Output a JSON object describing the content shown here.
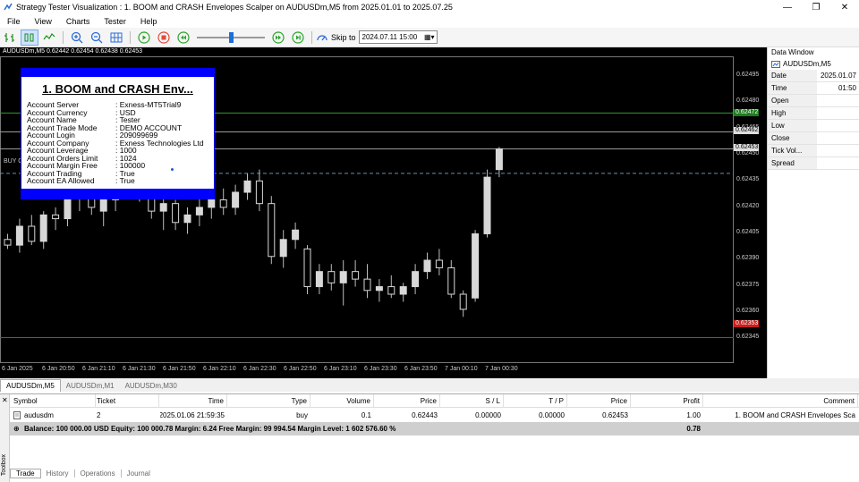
{
  "window": {
    "title": "Strategy Tester Visualization : 1. BOOM and CRASH Envelopes Scalper on AUDUSDm,M5 from 2025.01.01 to 2025.07.25"
  },
  "menu": [
    "File",
    "View",
    "Charts",
    "Tester",
    "Help"
  ],
  "toolbar": {
    "skip_label": "Skip to",
    "skip_date": "2024.07.11 15:00",
    "speed_fraction": 0.5
  },
  "chart": {
    "header": "AUDUSDm,M5  0.62442 0.62454 0.62438 0.62453",
    "buy_label": "BUY C",
    "price_labels": [
      "0.62495",
      "0.62480",
      "0.62465",
      "0.62450",
      "0.62435",
      "0.62420",
      "0.62405",
      "0.62390",
      "0.62375",
      "0.62360",
      "0.62345"
    ],
    "tag_green": "0.62472",
    "tag_gray1": "0.62462",
    "tag_gray2": "0.62453",
    "tag_red": "0.62353",
    "time_labels": [
      "6 Jan 2025",
      "6 Jan 20:50",
      "6 Jan 21:10",
      "6 Jan 21:30",
      "6 Jan 21:50",
      "6 Jan 22:10",
      "6 Jan 22:30",
      "6 Jan 22:50",
      "6 Jan 23:10",
      "6 Jan 23:30",
      "6 Jan 23:50",
      "7 Jan 00:10",
      "7 Jan 00:30"
    ]
  },
  "chart_data": {
    "type": "candlestick",
    "ohlc": [
      [
        0.62405,
        0.62408,
        0.624,
        0.62402
      ],
      [
        0.62402,
        0.62416,
        0.62398,
        0.62412
      ],
      [
        0.62412,
        0.62418,
        0.62402,
        0.62404
      ],
      [
        0.62404,
        0.6242,
        0.624,
        0.62418
      ],
      [
        0.62418,
        0.62422,
        0.6241,
        0.62416
      ],
      [
        0.62416,
        0.6244,
        0.62412,
        0.62435
      ],
      [
        0.6243,
        0.62444,
        0.6242,
        0.6244
      ],
      [
        0.6244,
        0.62444,
        0.62418,
        0.62422
      ],
      [
        0.6242,
        0.6243,
        0.62412,
        0.62426
      ],
      [
        0.62426,
        0.62438,
        0.6242,
        0.62432
      ],
      [
        0.6244,
        0.6245,
        0.6243,
        0.62442
      ],
      [
        0.62438,
        0.62445,
        0.62425,
        0.6243
      ],
      [
        0.62428,
        0.6244,
        0.62416,
        0.6242
      ],
      [
        0.6242,
        0.62428,
        0.6241,
        0.62424
      ],
      [
        0.62424,
        0.62426,
        0.6241,
        0.62414
      ],
      [
        0.62414,
        0.62422,
        0.62408,
        0.62418
      ],
      [
        0.62418,
        0.62428,
        0.62412,
        0.62422
      ],
      [
        0.62422,
        0.6243,
        0.62416,
        0.62426
      ],
      [
        0.62426,
        0.62432,
        0.62418,
        0.62422
      ],
      [
        0.62422,
        0.62434,
        0.62418,
        0.6243
      ],
      [
        0.6243,
        0.6244,
        0.62426,
        0.62436
      ],
      [
        0.62436,
        0.62442,
        0.6242,
        0.62424
      ],
      [
        0.62424,
        0.62428,
        0.62392,
        0.62396
      ],
      [
        0.62396,
        0.6241,
        0.6239,
        0.62405
      ],
      [
        0.62405,
        0.62414,
        0.624,
        0.6241
      ],
      [
        0.624,
        0.62402,
        0.62376,
        0.6238
      ],
      [
        0.6238,
        0.62392,
        0.62376,
        0.62388
      ],
      [
        0.62388,
        0.62392,
        0.62378,
        0.62382
      ],
      [
        0.62382,
        0.62394,
        0.6237,
        0.62388
      ],
      [
        0.62388,
        0.62394,
        0.6238,
        0.62384
      ],
      [
        0.62384,
        0.62392,
        0.62374,
        0.62378
      ],
      [
        0.62378,
        0.62384,
        0.62372,
        0.6238
      ],
      [
        0.6238,
        0.62386,
        0.62374,
        0.62376
      ],
      [
        0.62376,
        0.62382,
        0.62372,
        0.6238
      ],
      [
        0.6238,
        0.62392,
        0.62376,
        0.62388
      ],
      [
        0.62388,
        0.62398,
        0.62384,
        0.62394
      ],
      [
        0.62394,
        0.624,
        0.62386,
        0.6239
      ],
      [
        0.6239,
        0.62394,
        0.62374,
        0.62376
      ],
      [
        0.62376,
        0.62378,
        0.62364,
        0.62368
      ],
      [
        0.62374,
        0.6241,
        0.62372,
        0.62408
      ],
      [
        0.62408,
        0.62442,
        0.62406,
        0.62438
      ],
      [
        0.62442,
        0.62454,
        0.62438,
        0.62453
      ]
    ],
    "ylim": [
      0.6234,
      0.62502
    ],
    "levels": [
      0.62472,
      0.62462,
      0.62453,
      0.6244,
      0.62353
    ]
  },
  "info_panel": {
    "title": "1. BOOM and CRASH Env...",
    "rows": [
      {
        "k": "Account Server",
        "v": ": Exness-MT5Trial9"
      },
      {
        "k": "Account Currency",
        "v": ": USD"
      },
      {
        "k": "Account Name",
        "v": ": Tester"
      },
      {
        "k": "Account Trade Mode",
        "v": ": DEMO ACCOUNT"
      },
      {
        "k": "Account Login",
        "v": ": 209099699"
      },
      {
        "k": "Account Company",
        "v": ": Exness Technologies Ltd"
      },
      {
        "k": "Account Leverage",
        "v": ": 1000"
      },
      {
        "k": "Account Orders Limit",
        "v": ": 1024"
      },
      {
        "k": "Account Margin Free",
        "v": ": 100000"
      },
      {
        "k": "Account Trading",
        "v": ": True"
      },
      {
        "k": "Account EA Allowed",
        "v": ": True"
      }
    ]
  },
  "data_window": {
    "title": "Data Window",
    "symbol": "AUDUSDm,M5",
    "rows": [
      {
        "k": "Date",
        "v": "2025.01.07"
      },
      {
        "k": "Time",
        "v": "01:50"
      },
      {
        "k": "Open",
        "v": ""
      },
      {
        "k": "High",
        "v": ""
      },
      {
        "k": "Low",
        "v": ""
      },
      {
        "k": "Close",
        "v": ""
      },
      {
        "k": "Tick Vol...",
        "v": ""
      },
      {
        "k": "Spread",
        "v": ""
      }
    ]
  },
  "chart_tabs": [
    "AUDUSDm,M5",
    "AUDUSDm,M1",
    "AUDUSDm,M30"
  ],
  "trade_table": {
    "headers": [
      "Symbol",
      "Ticket",
      "Time",
      "Type",
      "Volume",
      "Price",
      "S / L",
      "T / P",
      "Price",
      "Profit",
      "Comment"
    ],
    "row": [
      "audusdm",
      "2",
      "2025.01.06 21:59:35",
      "buy",
      "0.1",
      "0.62443",
      "0.00000",
      "0.00000",
      "0.62453",
      "1.00",
      "1. BOOM and CRASH Envelopes Sca"
    ],
    "balance": "Balance: 100 000.00 USD  Equity: 100 000.78  Margin: 6.24  Free Margin: 99 994.54  Margin Level: 1 602 576.60 %",
    "balance_profit": "0.78"
  },
  "terminal_tabs": [
    "Trade",
    "History",
    "Operations",
    "Journal"
  ],
  "toolbox_label": "Toolbox"
}
